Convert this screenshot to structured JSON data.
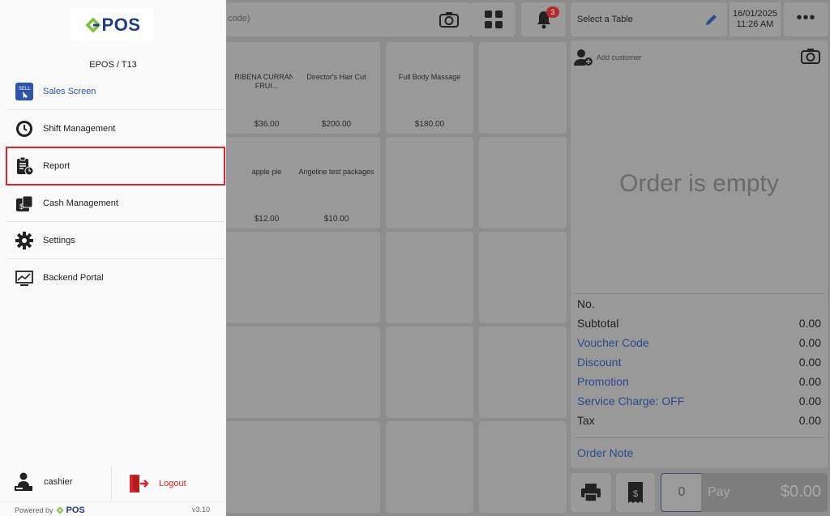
{
  "drawer": {
    "logo_text": "POS",
    "device_label": "EPOS / T13",
    "menu": [
      {
        "label": "Sales Screen",
        "icon": "sell-icon"
      },
      {
        "label": "Shift Management",
        "icon": "clock-icon"
      },
      {
        "label": "Report",
        "icon": "report-icon"
      },
      {
        "label": "Cash Management",
        "icon": "cash-icon"
      },
      {
        "label": "Settings",
        "icon": "gear-icon"
      },
      {
        "label": "Backend Portal",
        "icon": "monitor-chart-icon"
      }
    ],
    "user_label": "cashier",
    "logout_label": "Logout",
    "powered_by_label": "Powered by",
    "powered_brand": "POS",
    "version": "v3.10",
    "colors": {
      "active": "#2d54a8",
      "highlight": "#d8262c",
      "logout": "#d8262c",
      "brand_green": "#7cbf3a",
      "brand_blue": "#1f3c8c"
    }
  },
  "pos": {
    "search_placeholder_fragment": "code)",
    "notification_count": "3",
    "table_label": "Select a Table",
    "date": "16/01/2025",
    "time": "11:26 AM",
    "more_label": "•••",
    "products": [
      {
        "name": "RIBENA CURRANT FRUI...",
        "price": "$36.00"
      },
      {
        "name": "Director's Hair Cut",
        "price": "$200.00"
      },
      {
        "name": "Full Body Massage",
        "price": "$180.00"
      },
      {
        "name": "",
        "price": ""
      },
      {
        "name": "apple pie",
        "price": "$12.00"
      },
      {
        "name": "Angeline test packages",
        "price": "$10.00"
      }
    ],
    "order": {
      "add_customer": "Add customer",
      "empty_text": "Order is empty",
      "summary": [
        {
          "key": "No.",
          "value": "",
          "link": false
        },
        {
          "key": "Subtotal",
          "value": "0.00",
          "link": false
        },
        {
          "key": "Voucher Code",
          "value": "0.00",
          "link": true
        },
        {
          "key": "Discount",
          "value": "0.00",
          "link": true
        },
        {
          "key": "Promotion",
          "value": "0.00",
          "link": true
        },
        {
          "key": "Service Charge: OFF",
          "value": "0.00",
          "link": true
        },
        {
          "key": "Tax",
          "value": "0.00",
          "link": false
        }
      ],
      "note_label": "Order Note"
    },
    "quantity": "0",
    "pay_label": "Pay",
    "pay_amount": "$0.00"
  }
}
